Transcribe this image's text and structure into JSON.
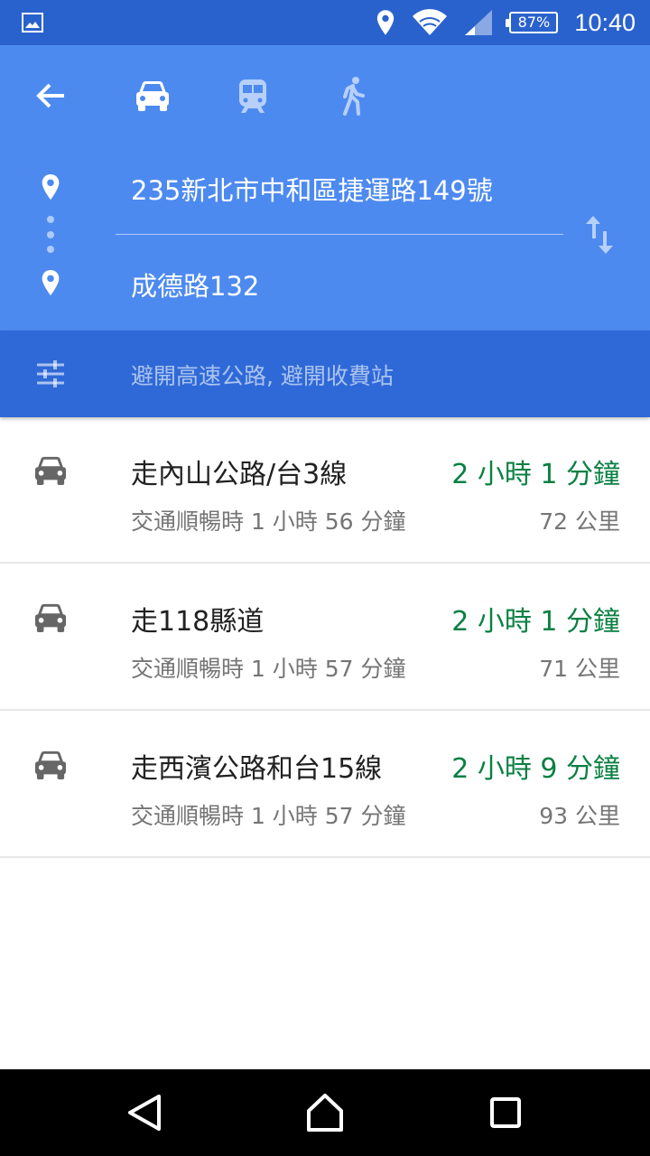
{
  "status_bar": {
    "battery": "87%",
    "time": "10:40"
  },
  "header": {
    "modes": [
      "car-icon",
      "train-icon",
      "walk-icon"
    ],
    "origin": "235新北市中和區捷運路149號",
    "destination": "成德路132"
  },
  "options": {
    "label": "避開高速公路, 避開收費站"
  },
  "routes": [
    {
      "name": "走內山公路/台3線",
      "duration": "2 小時 1 分鐘",
      "traffic": "交通順暢時 1 小時 56 分鐘",
      "distance": "72 公里"
    },
    {
      "name": "走118縣道",
      "duration": "2 小時 1 分鐘",
      "traffic": "交通順暢時 1 小時 57 分鐘",
      "distance": "71 公里"
    },
    {
      "name": "走西濱公路和台15線",
      "duration": "2 小時 9 分鐘",
      "traffic": "交通順暢時 1 小時 57 分鐘",
      "distance": "93 公里"
    }
  ],
  "colors": {
    "header": "#4d8af0",
    "status_bar": "#2a62cd",
    "options_bar": "#2f69d8",
    "duration": "#0b8043"
  }
}
